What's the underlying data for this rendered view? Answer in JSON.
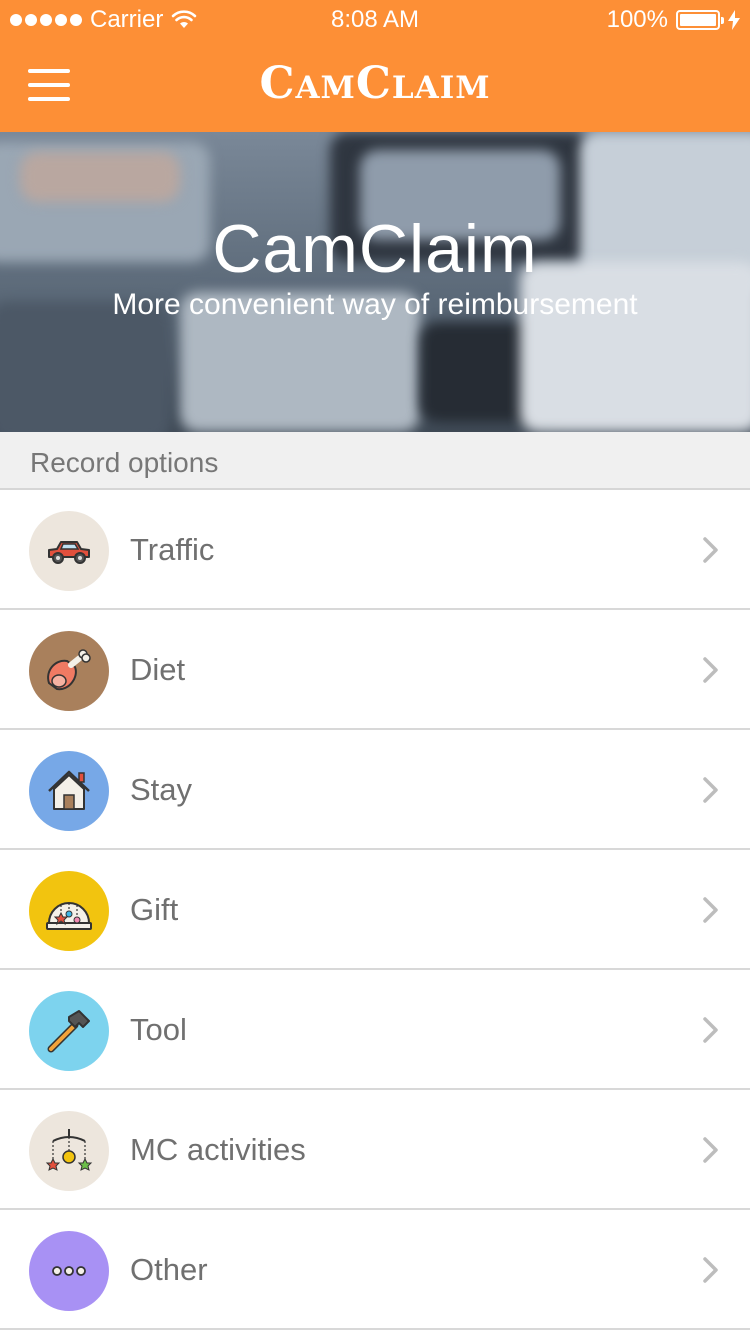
{
  "status_bar": {
    "carrier": "Carrier",
    "time": "8:08 AM",
    "battery": "100%"
  },
  "nav": {
    "logo": "CamClaim",
    "menu_icon": "hamburger-menu-icon"
  },
  "banner": {
    "title": "CamClaim",
    "subtitle": "More convenient way of reimbursement"
  },
  "section": {
    "title": "Record options"
  },
  "options": [
    {
      "label": "Traffic",
      "icon": "car-icon",
      "color": "#ede6dd"
    },
    {
      "label": "Diet",
      "icon": "ham-leg-icon",
      "color": "#a9805c"
    },
    {
      "label": "Stay",
      "icon": "house-icon",
      "color": "#77a8e7"
    },
    {
      "label": "Gift",
      "icon": "gift-icon",
      "color": "#f2c40f"
    },
    {
      "label": "Tool",
      "icon": "hammer-icon",
      "color": "#7dd3ee"
    },
    {
      "label": "MC activities",
      "icon": "mobile-ornament-icon",
      "color": "#ede6dd"
    },
    {
      "label": "Other",
      "icon": "more-dots-icon",
      "color": "#a891f4"
    }
  ],
  "colors": {
    "brand": "#fd8f36",
    "row_text": "#707070",
    "chevron": "#bdbdbd"
  }
}
